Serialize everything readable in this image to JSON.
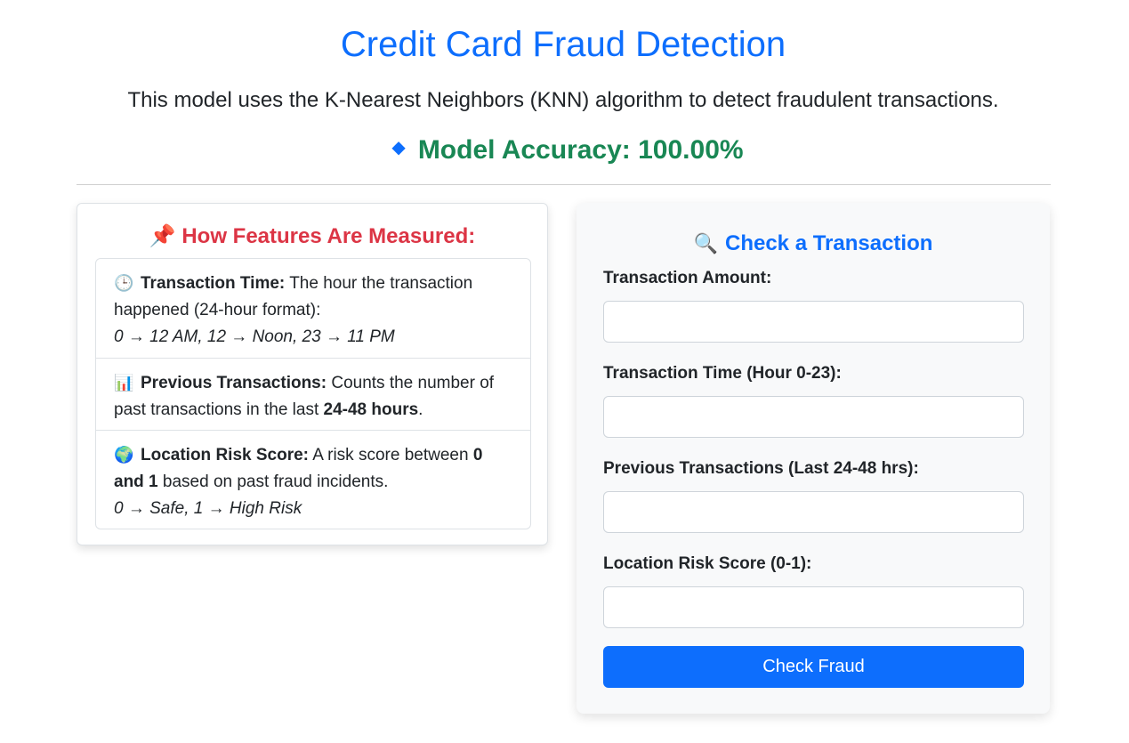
{
  "header": {
    "title": "Credit Card Fraud Detection",
    "description": "This model uses the K-Nearest Neighbors (KNN) algorithm to detect fraudulent transactions.",
    "accuracy_icon": "◆",
    "accuracy_label": "Model Accuracy:",
    "accuracy_value": "100.00%"
  },
  "features": {
    "heading_icon": "📌",
    "heading": "How Features Are Measured:",
    "items": [
      {
        "icon": "🕒",
        "name": "Transaction Time:",
        "text": " The hour the transaction happened (24-hour format):",
        "example": "0 → 12 AM, 12 → Noon, 23 → 11 PM"
      },
      {
        "icon": "📊",
        "name": "Previous Transactions:",
        "text": " Counts the number of past transactions in the last ",
        "bold": "24-48 hours",
        "tail": "."
      },
      {
        "icon": "🌍",
        "name": "Location Risk Score:",
        "text": " A risk score between ",
        "bold": "0 and 1",
        "tail": " based on past fraud incidents.",
        "example": "0 → Safe, 1 → High Risk"
      }
    ]
  },
  "form": {
    "heading_icon": "🔍",
    "heading": "Check a Transaction",
    "fields": [
      {
        "label": "Transaction Amount:",
        "value": "",
        "placeholder": ""
      },
      {
        "label": "Transaction Time (Hour 0-23):",
        "value": "",
        "placeholder": ""
      },
      {
        "label": "Previous Transactions (Last 24-48 hrs):",
        "value": "",
        "placeholder": ""
      },
      {
        "label": "Location Risk Score (0-1):",
        "value": "",
        "placeholder": ""
      }
    ],
    "submit_label": "Check Fraud"
  },
  "colors": {
    "primary": "#0d6efd",
    "success": "#198754",
    "danger": "#dc3545"
  }
}
